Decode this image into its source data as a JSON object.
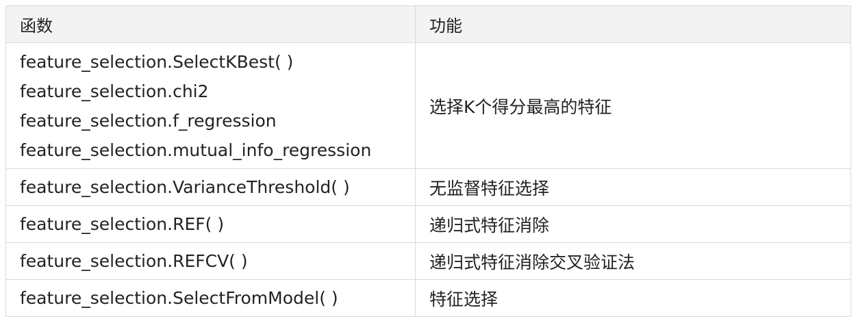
{
  "table": {
    "headers": {
      "function": "函数",
      "description": "功能"
    },
    "rows": [
      {
        "functions": [
          "feature_selection.SelectKBest( )",
          "feature_selection.chi2",
          "feature_selection.f_regression",
          "feature_selection.mutual_info_regression"
        ],
        "description": "选择K个得分最高的特征"
      },
      {
        "functions": [
          "feature_selection.VarianceThreshold( )"
        ],
        "description": "无监督特征选择"
      },
      {
        "functions": [
          "feature_selection.REF( )"
        ],
        "description": "递归式特征消除"
      },
      {
        "functions": [
          "feature_selection.REFCV( )"
        ],
        "description": "递归式特征消除交叉验证法"
      },
      {
        "functions": [
          "feature_selection.SelectFromModel( )"
        ],
        "description": "特征选择"
      }
    ]
  }
}
